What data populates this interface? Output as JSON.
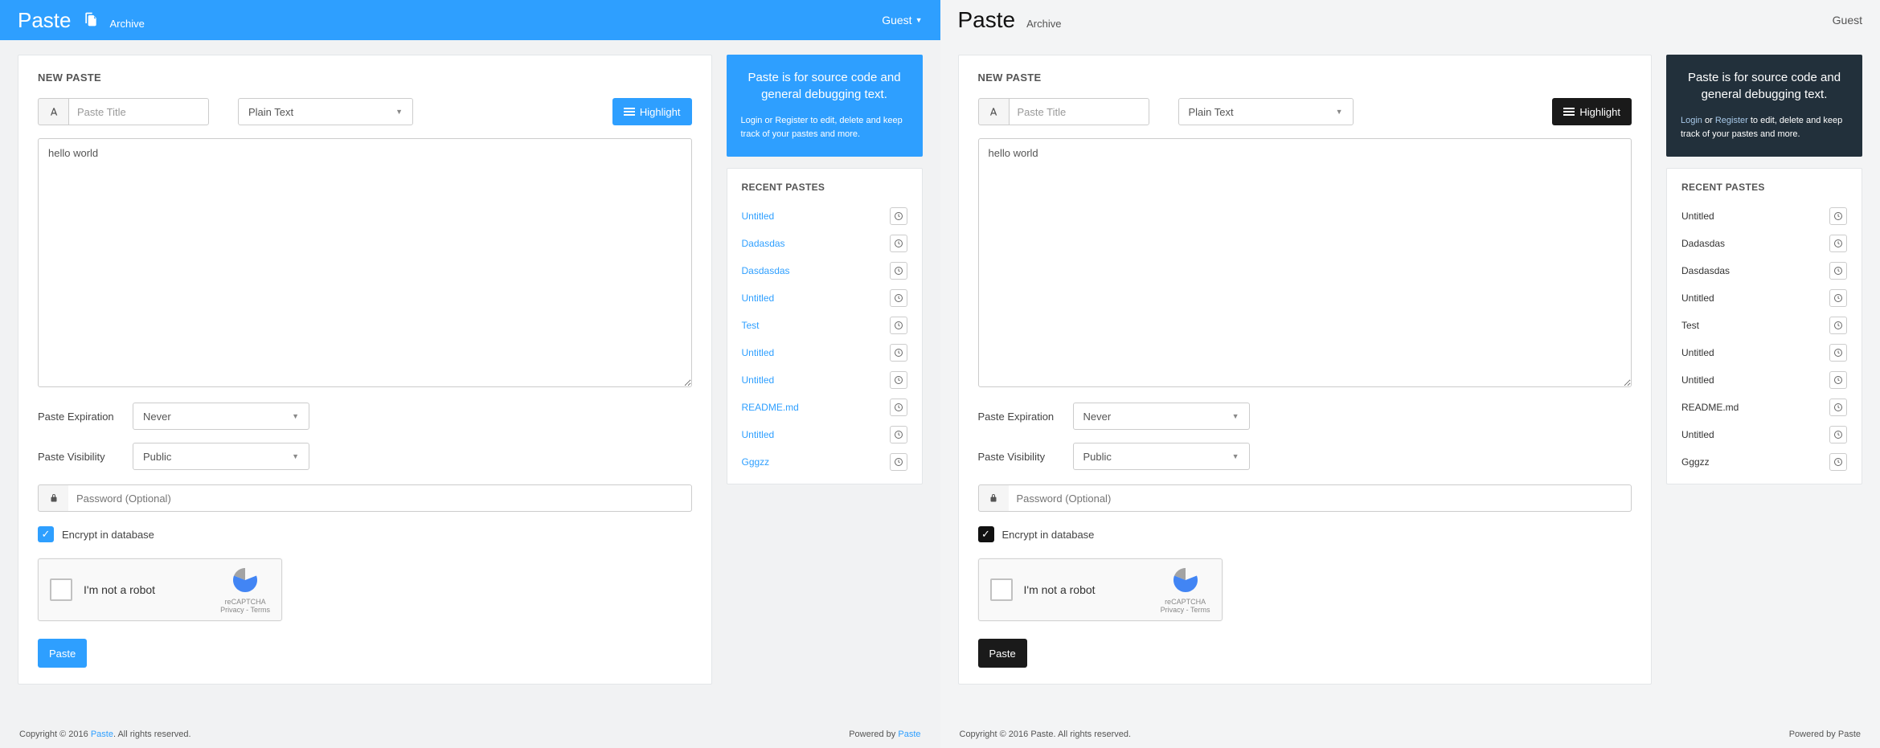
{
  "brand": "Paste",
  "nav": {
    "archive": "Archive",
    "guest": "Guest"
  },
  "main": {
    "title": "NEW PASTE",
    "paste_title_placeholder": "Paste Title",
    "syntax_selected": "Plain Text",
    "highlight_btn": "Highlight",
    "content": "hello world",
    "expiration_label": "Paste Expiration",
    "expiration_value": "Never",
    "visibility_label": "Paste Visibility",
    "visibility_value": "Public",
    "password_placeholder": "Password (Optional)",
    "encrypt_label": "Encrypt in database",
    "recaptcha_label": "I'm not a robot",
    "recaptcha_brand": "reCAPTCHA",
    "recaptcha_terms": "Privacy - Terms",
    "submit_btn": "Paste"
  },
  "info": {
    "title": "Paste is for source code and general debugging text.",
    "login": "Login",
    "or": " or ",
    "register": "Register",
    "tail": " to edit, delete and keep track of your pastes and more."
  },
  "recent": {
    "title": "RECENT PASTES",
    "items": [
      {
        "label": "Untitled"
      },
      {
        "label": "Dadasdas"
      },
      {
        "label": "Dasdasdas"
      },
      {
        "label": "Untitled"
      },
      {
        "label": "Test"
      },
      {
        "label": "Untitled"
      },
      {
        "label": "Untitled"
      },
      {
        "label": "README.md"
      },
      {
        "label": "Untitled"
      },
      {
        "label": "Gggzz"
      }
    ]
  },
  "footer": {
    "copyright_prefix": "Copyright © 2016 ",
    "copyright_brand": "Paste",
    "copyright_suffix": ". All rights reserved.",
    "powered_prefix": "Powered by ",
    "powered_brand": "Paste"
  }
}
